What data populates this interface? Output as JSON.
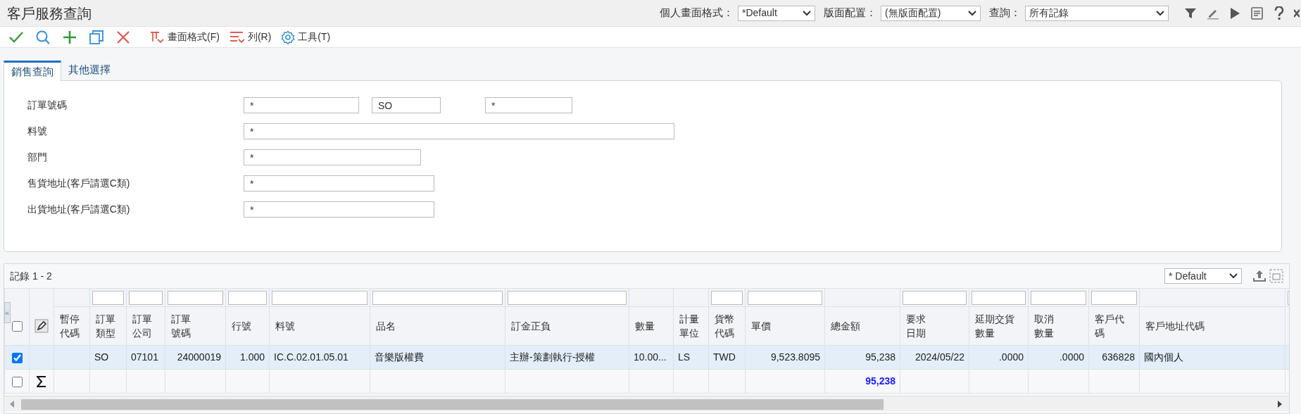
{
  "window": {
    "title": "客戶服務查詢"
  },
  "header_controls": [
    {
      "label": "個人畫面格式：",
      "value": "*Default"
    },
    {
      "label": "版面配置：",
      "value": "(無版面配置)"
    },
    {
      "label": "查詢：",
      "value": "所有記錄"
    }
  ],
  "toolbar": {
    "icon_buttons": [
      {
        "kind": "check"
      },
      {
        "kind": "search"
      },
      {
        "kind": "add"
      },
      {
        "kind": "copy"
      },
      {
        "kind": "delete"
      }
    ],
    "menu_buttons": [
      {
        "kind": "format",
        "label": "畫面格式(F)"
      },
      {
        "kind": "rows",
        "label": "列(R)"
      },
      {
        "kind": "tools",
        "label": "工具(T)"
      }
    ]
  },
  "tabs": [
    {
      "label": "銷售查詢",
      "selected": true
    },
    {
      "label": "其他選擇",
      "selected": false
    }
  ],
  "form": [
    {
      "label": "訂單號碼",
      "fields": [
        {
          "value": "*"
        },
        {
          "value": "SO"
        },
        {
          "value": "*"
        }
      ]
    },
    {
      "label": "料號",
      "fields": [
        {
          "value": "*"
        }
      ]
    },
    {
      "label": "部門",
      "fields": [
        {
          "value": "*"
        }
      ]
    },
    {
      "label": "售貨地址(客戶請選C類)",
      "fields": [
        {
          "value": "*"
        }
      ]
    },
    {
      "label": "出貨地址(客戶請選C類)",
      "fields": [
        {
          "value": "*"
        }
      ]
    }
  ],
  "grid": {
    "record_label": "記錄 1 - 2",
    "format_value": "* Default",
    "collapse_handle": "«",
    "select_all_checked": false,
    "columns": [
      {
        "label": [
          "暫停",
          "代碼"
        ],
        "filter": false
      },
      {
        "label": [
          "訂單",
          "類型"
        ],
        "filter": true
      },
      {
        "label": [
          "訂單",
          "公司"
        ],
        "filter": true
      },
      {
        "label": [
          "訂單",
          "號碼"
        ],
        "filter": true
      },
      {
        "label": [
          "行號"
        ],
        "filter": true
      },
      {
        "label": [
          "料號"
        ],
        "filter": true
      },
      {
        "label": [
          "品名"
        ],
        "filter": true
      },
      {
        "label": [
          "訂金正負"
        ],
        "filter": true
      },
      {
        "label": [
          "數量"
        ],
        "filter": false
      },
      {
        "label": [
          "計量",
          "單位"
        ],
        "filter": false
      },
      {
        "label": [
          "貨幣",
          "代碼"
        ],
        "filter": true
      },
      {
        "label": [
          "單價"
        ],
        "filter": true
      },
      {
        "label": [
          "總金額"
        ],
        "filter": false
      },
      {
        "label": [
          "要求",
          "日期"
        ],
        "filter": true
      },
      {
        "label": [
          "延期交貨",
          "數量"
        ],
        "filter": true
      },
      {
        "label": [
          "取消",
          "數量"
        ],
        "filter": true
      },
      {
        "label": [
          "客戶代",
          "碼"
        ],
        "filter": true
      },
      {
        "label": [
          "客戶地址代碼"
        ],
        "filter": false
      },
      {
        "filter": true
      }
    ],
    "rows": [
      {
        "checked": true,
        "selected": true,
        "cells": [
          null,
          "SO",
          "07101",
          "24000019",
          "1.000",
          "IC.C.02.01.05.01",
          "音樂版權費",
          "主辦-策劃執行-授權",
          "10.00...",
          "LS",
          "TWD",
          "9,523.8095",
          "95,238",
          "2024/05/22",
          ".0000",
          ".0000",
          "636828",
          "國內個人",
          null
        ]
      }
    ],
    "totals": {
      "checked": false,
      "cells": [
        null,
        null,
        null,
        null,
        null,
        null,
        null,
        null,
        null,
        null,
        null,
        null,
        "95,238",
        null,
        null,
        null,
        null,
        null,
        null
      ]
    }
  }
}
